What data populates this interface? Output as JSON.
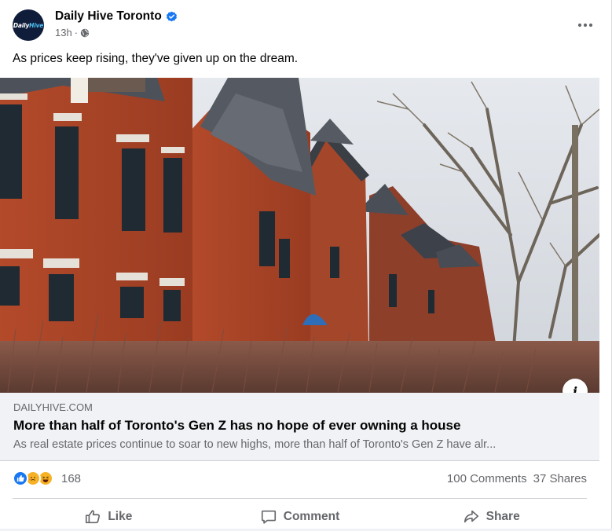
{
  "post": {
    "page_name": "Daily Hive Toronto",
    "avatar_text_a": "Daily",
    "avatar_text_b": "Hive",
    "timestamp": "13h",
    "separator": "·",
    "audience_icon": "globe-icon",
    "more_icon": "more-options-icon",
    "caption": "As prices keep rising, they've given up on the dream."
  },
  "link_preview": {
    "domain": "DAILYHIVE.COM",
    "headline": "More than half of Toronto's Gen Z has no hope of ever owning a house",
    "description": "As real estate prices continue to soar to new highs, more than half of Toronto's Gen Z have alr...",
    "info_label": "i"
  },
  "stats": {
    "reaction_icons": [
      "like-reaction-icon",
      "care-reaction-icon",
      "haha-reaction-icon"
    ],
    "reaction_count": "168",
    "comments": "100 Comments",
    "shares": "37 Shares"
  },
  "actions": {
    "like_label": "Like",
    "comment_label": "Comment",
    "share_label": "Share"
  },
  "colors": {
    "brand_blue": "#1877f2",
    "secondary_text": "#65676b",
    "link_bg": "#f0f2f5"
  }
}
